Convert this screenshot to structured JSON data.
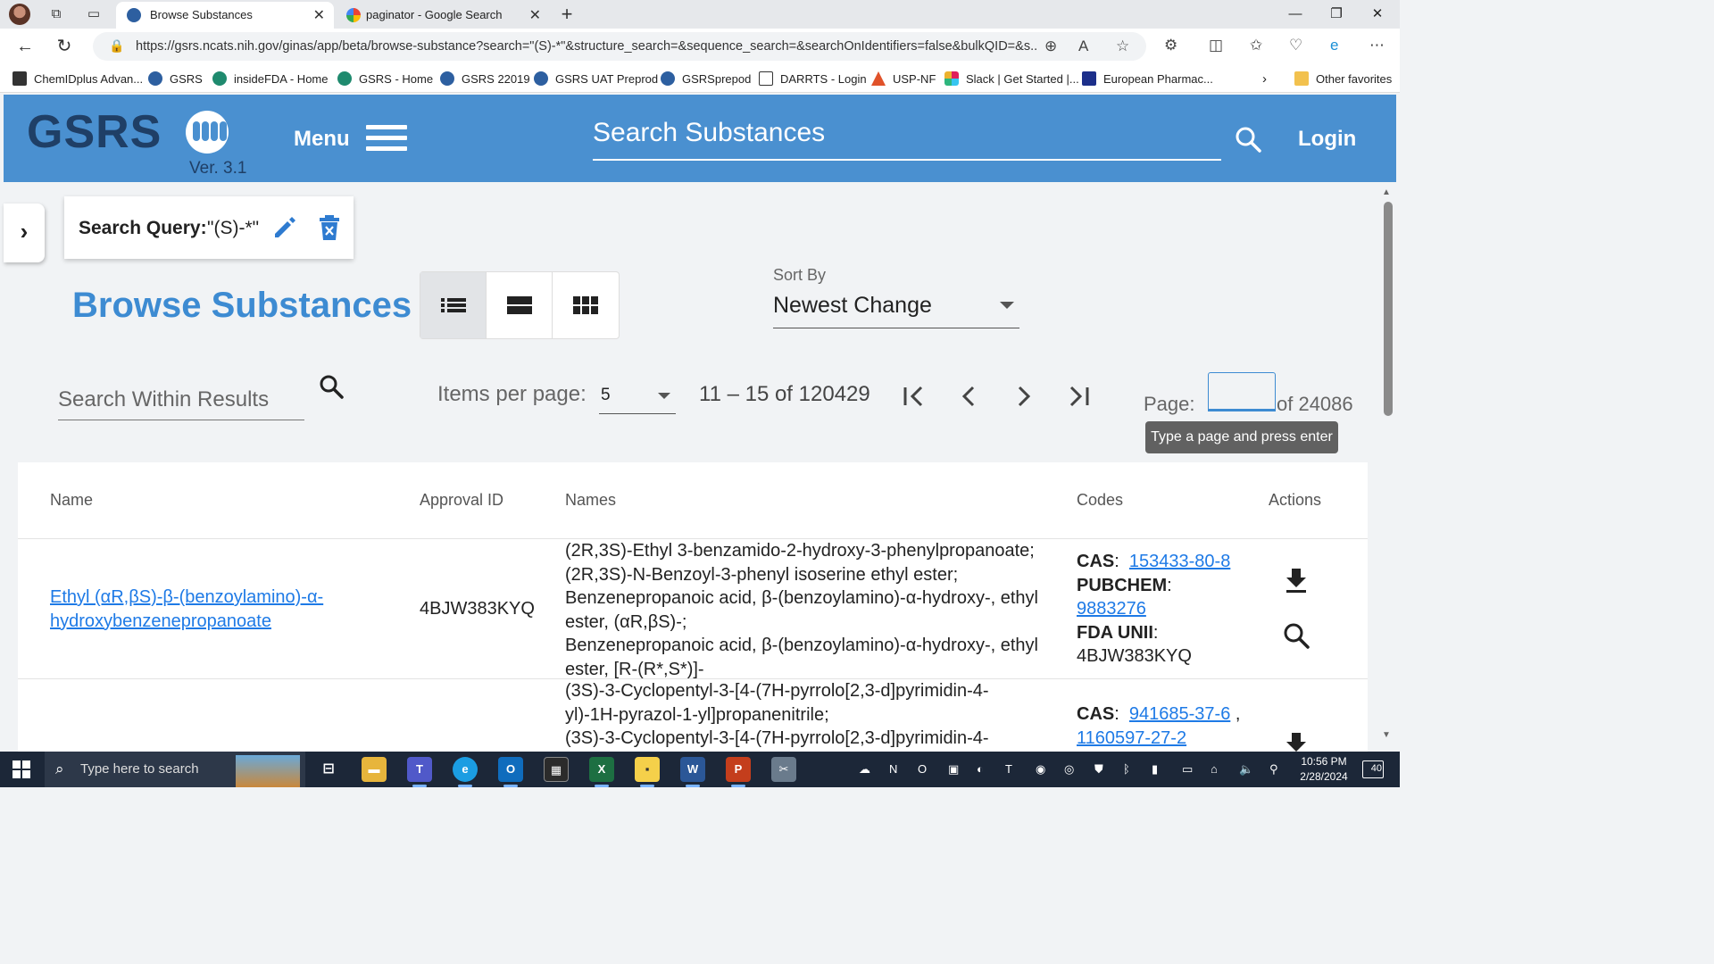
{
  "browser": {
    "tabs": [
      {
        "title": "Browse Substances",
        "active": true
      },
      {
        "title": "paginator - Google Search",
        "active": false
      }
    ],
    "url": "https://gsrs.ncats.nih.gov/ginas/app/beta/browse-substance?search=\"(S)-*\"&structure_search=&sequence_search=&searchOnIdentifiers=false&bulkQID=&s...",
    "favorites": [
      "ChemIDplus Advan...",
      "GSRS",
      "insideFDA - Home",
      "GSRS - Home",
      "GSRS 22019",
      "GSRS UAT Preprod",
      "GSRSprepod",
      "DARRTS - Login",
      "USP-NF",
      "Slack | Get Started |...",
      "European Pharmac..."
    ],
    "other_favorites": "Other favorites"
  },
  "header": {
    "logo": "GSRS",
    "version": "Ver. 3.1",
    "menu_label": "Menu",
    "search_placeholder": "Search Substances",
    "login_label": "Login",
    "brand_color": "#4a90d0"
  },
  "query": {
    "label": "Search Query:",
    "value": "\"(S)-*\""
  },
  "page": {
    "title": "Browse Substances",
    "sort_label": "Sort By",
    "sort_value": "Newest Change",
    "search_within_placeholder": "Search Within Results"
  },
  "paginator": {
    "items_per_page_label": "Items per page:",
    "items_per_page": "5",
    "range": "11 – 15 of 120429",
    "page_label": "Page:",
    "page_of": "of 24086",
    "tooltip": "Type a page and press enter"
  },
  "table": {
    "columns": [
      "Name",
      "Approval ID",
      "Names",
      "Codes",
      "Actions"
    ],
    "rows": [
      {
        "name_line1": "Ethyl (αR,βS)-β-(benzoylamino)-α-",
        "name_line2": "hydroxybenzenepropanoate",
        "approval_id": "4BJW383KYQ",
        "names": [
          "(2R,3S)-Ethyl 3-benzamido-2-hydroxy-3-phenylpropanoate;",
          "(2R,3S)-N-Benzoyl-3-phenyl isoserine ethyl ester;",
          "Benzenepropanoic acid, β-(benzoylamino)-α-hydroxy-, ethyl",
          "ester, (αR,βS)-;",
          "Benzenepropanoic acid, β-(benzoylamino)-α-hydroxy-, ethyl",
          "ester, [R-(R*,S*)]-"
        ],
        "codes": {
          "cas_label": "CAS",
          "cas_value": "153433-80-8",
          "pubchem_label": "PUBCHEM",
          "pubchem_value": "9883276",
          "unii_label": "FDA UNII",
          "unii_value": "4BJW383KYQ"
        }
      },
      {
        "names": [
          "(3S)-3-Cyclopentyl-3-[4-(7H-pyrrolo[2,3-d]pyrimidin-4-",
          "yl)-1H-pyrazol-1-yl]propanenitrile;",
          "(3S)-3-Cyclopentyl-3-[4-(7H-pyrrolo[2,3-d]pyrimidin-4-"
        ],
        "codes": {
          "cas_label": "CAS",
          "cas_value1": "941685-37-6",
          "cas_value2": "1160597-27-2"
        }
      }
    ]
  },
  "taskbar": {
    "search_placeholder": "Type here to search",
    "time": "10:56 PM",
    "date": "2/28/2024",
    "notifications": "40"
  }
}
